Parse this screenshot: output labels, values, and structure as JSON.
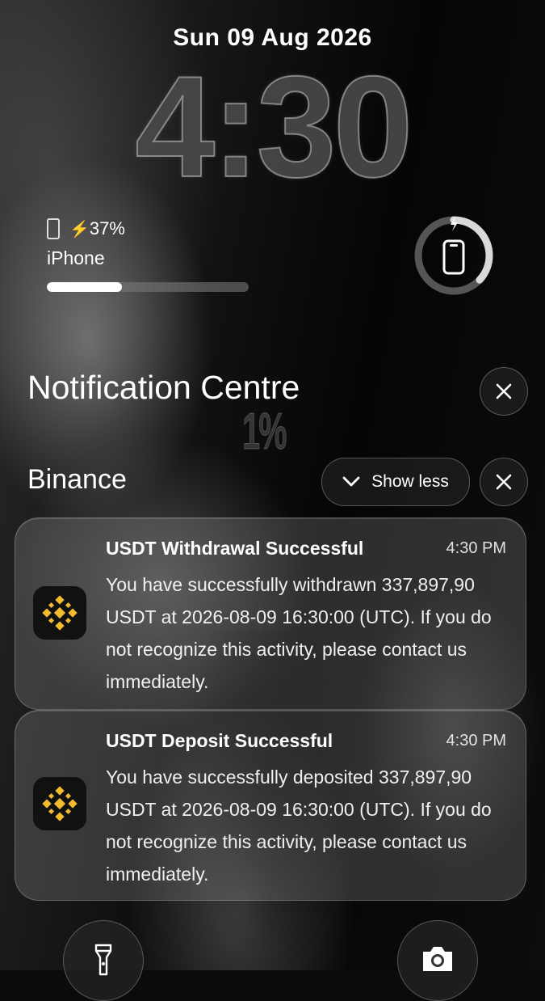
{
  "lock_screen": {
    "date": "Sun 09 Aug 2026",
    "time": "4:30"
  },
  "battery_widget": {
    "percent_label": "37%",
    "device": "iPhone",
    "level": 0.37,
    "icons": [
      "iphone-icon",
      "charging-bolt-icon"
    ]
  },
  "charge_ring": {
    "level": 0.37,
    "icons": [
      "charging-bolt-icon",
      "iphone-icon"
    ]
  },
  "notification_centre": {
    "title": "Notification Centre",
    "overlay_text": "1%"
  },
  "group": {
    "app_name": "Binance",
    "show_less_label": "Show less"
  },
  "notifications": [
    {
      "title": "USDT Withdrawal Successful",
      "time": "4:30 PM",
      "body": "You have successfully withdrawn 337,897,90 USDT at 2026-08-09 16:30:00 (UTC). If you do not recognize this activity, please contact us immediately."
    },
    {
      "title": "USDT Deposit Successful",
      "time": "4:30 PM",
      "body": "You have successfully deposited 337,897,90 USDT at 2026-08-09 16:30:00 (UTC). If you do not recognize this activity, please contact us immediately."
    }
  ],
  "colors": {
    "binance_yellow": "#F3BA2F",
    "ring_track": "#555555",
    "ring_fill": "#d9d9d9"
  },
  "quick_actions": [
    "flashlight-icon",
    "camera-icon"
  ]
}
